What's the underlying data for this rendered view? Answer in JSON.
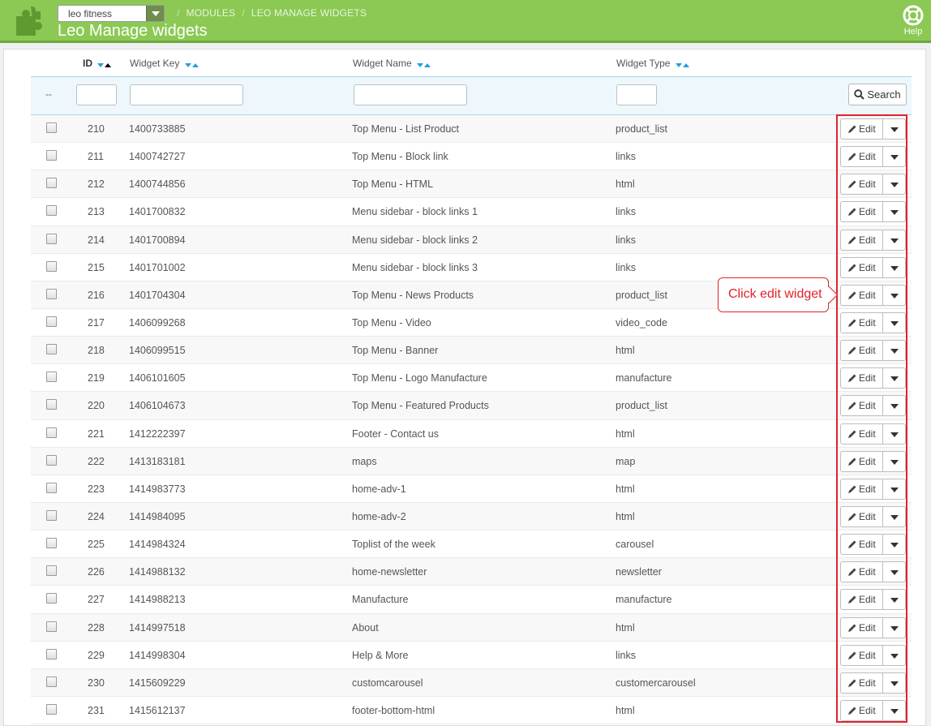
{
  "header": {
    "shop_select": "leo fitness",
    "breadcrumb": [
      "MODULES",
      "LEO MANAGE WIDGETS"
    ],
    "title": "Leo Manage widgets",
    "help_label": "Help"
  },
  "table": {
    "columns": {
      "id": "ID",
      "key": "Widget Key",
      "name": "Widget Name",
      "type": "Widget Type"
    },
    "filter_dash": "--",
    "search_label": "Search",
    "edit_label": "Edit",
    "rows": [
      {
        "id": "210",
        "key": "1400733885",
        "name": "Top Menu - List Product",
        "type": "product_list"
      },
      {
        "id": "211",
        "key": "1400742727",
        "name": "Top Menu - Block link",
        "type": "links"
      },
      {
        "id": "212",
        "key": "1400744856",
        "name": "Top Menu - HTML",
        "type": "html"
      },
      {
        "id": "213",
        "key": "1401700832",
        "name": "Menu sidebar - block links 1",
        "type": "links"
      },
      {
        "id": "214",
        "key": "1401700894",
        "name": "Menu sidebar - block links 2",
        "type": "links"
      },
      {
        "id": "215",
        "key": "1401701002",
        "name": "Menu sidebar - block links 3",
        "type": "links"
      },
      {
        "id": "216",
        "key": "1401704304",
        "name": "Top Menu - News Products",
        "type": "product_list"
      },
      {
        "id": "217",
        "key": "1406099268",
        "name": "Top Menu - Video",
        "type": "video_code"
      },
      {
        "id": "218",
        "key": "1406099515",
        "name": "Top Menu - Banner",
        "type": "html"
      },
      {
        "id": "219",
        "key": "1406101605",
        "name": "Top Menu - Logo Manufacture",
        "type": "manufacture"
      },
      {
        "id": "220",
        "key": "1406104673",
        "name": "Top Menu - Featured Products",
        "type": "product_list"
      },
      {
        "id": "221",
        "key": "1412222397",
        "name": "Footer - Contact us",
        "type": "html"
      },
      {
        "id": "222",
        "key": "1413183181",
        "name": "maps",
        "type": "map"
      },
      {
        "id": "223",
        "key": "1414983773",
        "name": "home-adv-1",
        "type": "html"
      },
      {
        "id": "224",
        "key": "1414984095",
        "name": "home-adv-2",
        "type": "html"
      },
      {
        "id": "225",
        "key": "1414984324",
        "name": "Toplist of the week",
        "type": "carousel"
      },
      {
        "id": "226",
        "key": "1414988132",
        "name": "home-newsletter",
        "type": "newsletter"
      },
      {
        "id": "227",
        "key": "1414988213",
        "name": "Manufacture",
        "type": "manufacture"
      },
      {
        "id": "228",
        "key": "1414997518",
        "name": "About",
        "type": "html"
      },
      {
        "id": "229",
        "key": "1414998304",
        "name": "Help & More",
        "type": "links"
      },
      {
        "id": "230",
        "key": "1415609229",
        "name": "customcarousel",
        "type": "customercarousel"
      },
      {
        "id": "231",
        "key": "1415612137",
        "name": "footer-bottom-html",
        "type": "html"
      }
    ]
  },
  "annotation": {
    "callout_text": "Click edit widget",
    "color": "#e0232b"
  },
  "colors": {
    "header_green": "#8bc954",
    "sort_arrow_blue": "#20a1db"
  },
  "icons": [
    "puzzle-icon",
    "help-lifebuoy-icon",
    "search-icon",
    "pencil-icon",
    "caret-down-icon"
  ]
}
